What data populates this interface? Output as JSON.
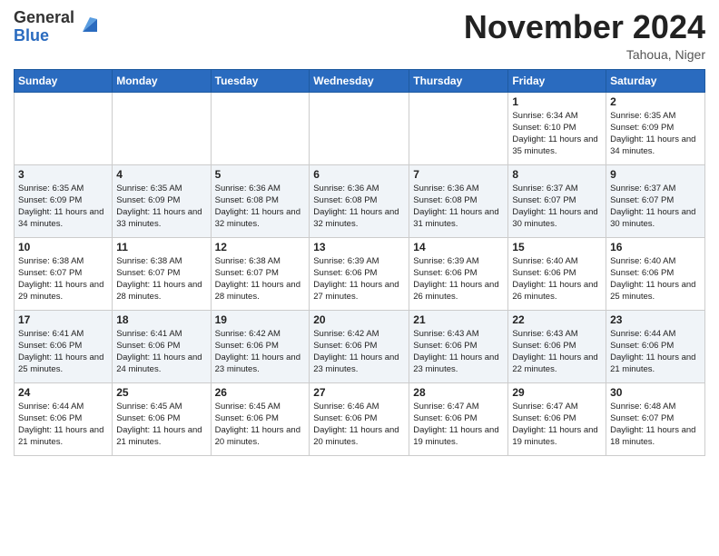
{
  "logo": {
    "general": "General",
    "blue": "Blue"
  },
  "header": {
    "month": "November 2024",
    "location": "Tahoua, Niger"
  },
  "days_of_week": [
    "Sunday",
    "Monday",
    "Tuesday",
    "Wednesday",
    "Thursday",
    "Friday",
    "Saturday"
  ],
  "weeks": [
    [
      {
        "day": "",
        "info": ""
      },
      {
        "day": "",
        "info": ""
      },
      {
        "day": "",
        "info": ""
      },
      {
        "day": "",
        "info": ""
      },
      {
        "day": "",
        "info": ""
      },
      {
        "day": "1",
        "info": "Sunrise: 6:34 AM\nSunset: 6:10 PM\nDaylight: 11 hours and 35 minutes."
      },
      {
        "day": "2",
        "info": "Sunrise: 6:35 AM\nSunset: 6:09 PM\nDaylight: 11 hours and 34 minutes."
      }
    ],
    [
      {
        "day": "3",
        "info": "Sunrise: 6:35 AM\nSunset: 6:09 PM\nDaylight: 11 hours and 34 minutes."
      },
      {
        "day": "4",
        "info": "Sunrise: 6:35 AM\nSunset: 6:09 PM\nDaylight: 11 hours and 33 minutes."
      },
      {
        "day": "5",
        "info": "Sunrise: 6:36 AM\nSunset: 6:08 PM\nDaylight: 11 hours and 32 minutes."
      },
      {
        "day": "6",
        "info": "Sunrise: 6:36 AM\nSunset: 6:08 PM\nDaylight: 11 hours and 32 minutes."
      },
      {
        "day": "7",
        "info": "Sunrise: 6:36 AM\nSunset: 6:08 PM\nDaylight: 11 hours and 31 minutes."
      },
      {
        "day": "8",
        "info": "Sunrise: 6:37 AM\nSunset: 6:07 PM\nDaylight: 11 hours and 30 minutes."
      },
      {
        "day": "9",
        "info": "Sunrise: 6:37 AM\nSunset: 6:07 PM\nDaylight: 11 hours and 30 minutes."
      }
    ],
    [
      {
        "day": "10",
        "info": "Sunrise: 6:38 AM\nSunset: 6:07 PM\nDaylight: 11 hours and 29 minutes."
      },
      {
        "day": "11",
        "info": "Sunrise: 6:38 AM\nSunset: 6:07 PM\nDaylight: 11 hours and 28 minutes."
      },
      {
        "day": "12",
        "info": "Sunrise: 6:38 AM\nSunset: 6:07 PM\nDaylight: 11 hours and 28 minutes."
      },
      {
        "day": "13",
        "info": "Sunrise: 6:39 AM\nSunset: 6:06 PM\nDaylight: 11 hours and 27 minutes."
      },
      {
        "day": "14",
        "info": "Sunrise: 6:39 AM\nSunset: 6:06 PM\nDaylight: 11 hours and 26 minutes."
      },
      {
        "day": "15",
        "info": "Sunrise: 6:40 AM\nSunset: 6:06 PM\nDaylight: 11 hours and 26 minutes."
      },
      {
        "day": "16",
        "info": "Sunrise: 6:40 AM\nSunset: 6:06 PM\nDaylight: 11 hours and 25 minutes."
      }
    ],
    [
      {
        "day": "17",
        "info": "Sunrise: 6:41 AM\nSunset: 6:06 PM\nDaylight: 11 hours and 25 minutes."
      },
      {
        "day": "18",
        "info": "Sunrise: 6:41 AM\nSunset: 6:06 PM\nDaylight: 11 hours and 24 minutes."
      },
      {
        "day": "19",
        "info": "Sunrise: 6:42 AM\nSunset: 6:06 PM\nDaylight: 11 hours and 23 minutes."
      },
      {
        "day": "20",
        "info": "Sunrise: 6:42 AM\nSunset: 6:06 PM\nDaylight: 11 hours and 23 minutes."
      },
      {
        "day": "21",
        "info": "Sunrise: 6:43 AM\nSunset: 6:06 PM\nDaylight: 11 hours and 23 minutes."
      },
      {
        "day": "22",
        "info": "Sunrise: 6:43 AM\nSunset: 6:06 PM\nDaylight: 11 hours and 22 minutes."
      },
      {
        "day": "23",
        "info": "Sunrise: 6:44 AM\nSunset: 6:06 PM\nDaylight: 11 hours and 21 minutes."
      }
    ],
    [
      {
        "day": "24",
        "info": "Sunrise: 6:44 AM\nSunset: 6:06 PM\nDaylight: 11 hours and 21 minutes."
      },
      {
        "day": "25",
        "info": "Sunrise: 6:45 AM\nSunset: 6:06 PM\nDaylight: 11 hours and 21 minutes."
      },
      {
        "day": "26",
        "info": "Sunrise: 6:45 AM\nSunset: 6:06 PM\nDaylight: 11 hours and 20 minutes."
      },
      {
        "day": "27",
        "info": "Sunrise: 6:46 AM\nSunset: 6:06 PM\nDaylight: 11 hours and 20 minutes."
      },
      {
        "day": "28",
        "info": "Sunrise: 6:47 AM\nSunset: 6:06 PM\nDaylight: 11 hours and 19 minutes."
      },
      {
        "day": "29",
        "info": "Sunrise: 6:47 AM\nSunset: 6:06 PM\nDaylight: 11 hours and 19 minutes."
      },
      {
        "day": "30",
        "info": "Sunrise: 6:48 AM\nSunset: 6:07 PM\nDaylight: 11 hours and 18 minutes."
      }
    ]
  ]
}
